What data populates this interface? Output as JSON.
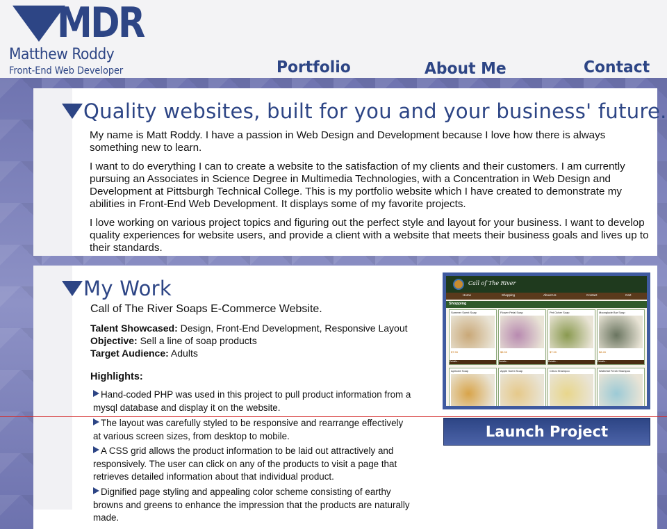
{
  "header": {
    "logo_text": "MDR",
    "name": "Matthew Roddy",
    "role": "Front-End Web Developer"
  },
  "nav": {
    "portfolio": "Portfolio",
    "about": "About Me",
    "contact": "Contact"
  },
  "intro": {
    "heading": "Quality websites, built for you  and your business' future.",
    "paragraphs": [
      "My name is Matt Roddy. I have a passion in Web Design and Development because I love how there is always something new to learn.",
      "I want to do everything I can to create a website to the satisfaction of my clients and their customers. I am currently pursuing an Associates in Science Degree in Multimedia Technologies, with a Concentration in Web Design and Development at Pittsburgh Technical College. This is my portfolio website which I have created to demonstrate my abilities in Front-End Web Development. It displays some of my favorite projects.",
      "I love working on various project topics and figuring out the perfect style and layout for your business. I want to develop quality experiences for website users, and provide a client with a website that meets their business goals and lives up to their standards."
    ]
  },
  "work": {
    "heading": "My Work",
    "project_title": "Call of The River Soaps E-Commerce Website.",
    "talent_label": "Talent Showcased:",
    "talent_value": "Design, Front-End Development, Responsive Layout",
    "objective_label": "Objective:",
    "objective_value": "Sell a line of soap products",
    "audience_label": "Target Audience:",
    "audience_value": "Adults",
    "highlights_title": "Highlights:",
    "highlights": [
      "Hand-coded PHP was used in this project to pull product information from a mysql database and display it on the website.",
      "The layout was carefully styled to be responsive and rearrange effectively at various screen sizes, from desktop to mobile.",
      "A CSS grid allows the product information to be laid out attractively and responsively. The user can click on any of the products to visit a page that retrieves detailed information about that individual product.",
      "Dignified page styling and appealing color scheme consisting of earthy browns and greens to enhance the impression that the products are naturally made."
    ],
    "launch_label": "Launch Project"
  },
  "preview": {
    "site_title": "Call of The River",
    "nav": [
      "Home",
      "Shopping",
      "About Us",
      "Contact",
      "Cart"
    ],
    "category": "Shopping",
    "products": [
      {
        "name": "Summer Scent Soap",
        "price": "$7.99",
        "color": "#c9a878"
      },
      {
        "name": "Flower Petal Soap",
        "price": "$8.99",
        "color": "#b88ab0"
      },
      {
        "name": "Pet Ocher Soap",
        "price": "$7.99",
        "color": "#8a9a50"
      },
      {
        "name": "Moonglade Bar Soap",
        "price": "$8.49",
        "color": "#6a7560"
      },
      {
        "name": "Apricote Soap",
        "price": "",
        "color": "#d8a44a"
      },
      {
        "name": "Apple Scent Soap",
        "price": "",
        "color": "#e6c98a"
      },
      {
        "name": "Citrus Shampoo",
        "price": "",
        "color": "#e8d68c"
      },
      {
        "name": "Waterfall Fresh Shampoo",
        "price": "",
        "color": "#9ccad6"
      }
    ],
    "details_label": "Details..."
  },
  "colors": {
    "brand": "#2d4585",
    "panel": "#ffffff",
    "background": "#7b7fb8"
  }
}
